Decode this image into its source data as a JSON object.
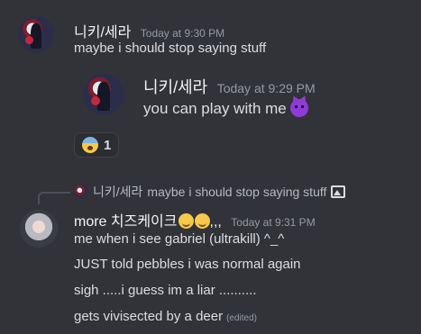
{
  "message1": {
    "username": "니키/세라",
    "timestamp": "Today at 9:30 PM",
    "content": "maybe i should stop saying stuff"
  },
  "embed": {
    "username": "니키/세라",
    "timestamp": "Today at 9:29 PM",
    "content": "you can play with me",
    "emoji": "smiling-imp-emoji"
  },
  "reaction": {
    "emoji": "fearful-face-emoji",
    "count": "1"
  },
  "reply": {
    "username": "니키/세라",
    "content": "maybe i should stop saying stuff",
    "attachment_icon": "image-icon"
  },
  "message2": {
    "username": "more 치즈케이크",
    "username_suffix": ",,,",
    "timestamp": "Today at 9:31 PM",
    "lines": [
      "me when i see gabriel (ultrakill) ^_^",
      "JUST told pebbles i was normal again",
      "sigh .....i guess im a liar ..........",
      "gets vivisected by a deer"
    ],
    "edited_label": "(edited)"
  },
  "colors": {
    "background": "#313338",
    "username": "#f2f3f5",
    "timestamp": "#949ba4",
    "text": "#dbdee1"
  }
}
